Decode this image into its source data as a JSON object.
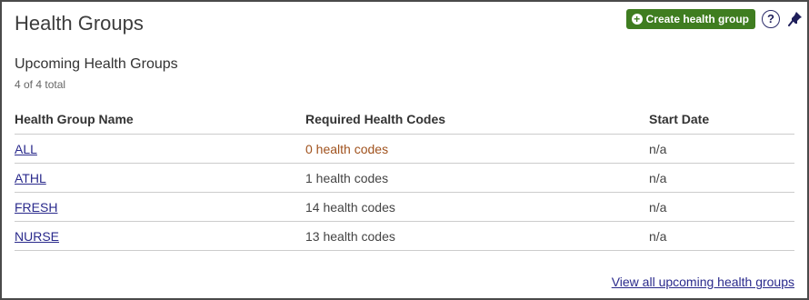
{
  "panel": {
    "title": "Health Groups",
    "create_button_label": "Create health group",
    "help_label": "?"
  },
  "section": {
    "title": "Upcoming Health Groups",
    "count": "4 of 4 total"
  },
  "table": {
    "headers": [
      "Health Group Name",
      "Required Health Codes",
      "Start Date"
    ],
    "rows": [
      {
        "name": "ALL",
        "codes": "0 health codes",
        "start": "n/a"
      },
      {
        "name": "ATHL",
        "codes": "1 health codes",
        "start": "n/a"
      },
      {
        "name": "FRESH",
        "codes": "14 health codes",
        "start": "n/a"
      },
      {
        "name": "NURSE",
        "codes": "13 health codes",
        "start": "n/a"
      }
    ]
  },
  "footer": {
    "view_all_label": "View all upcoming health groups"
  },
  "icons": {
    "create": "plus-circle-icon",
    "help": "question-icon",
    "pin": "pin-icon"
  },
  "colors": {
    "primary_button": "#3f7d20",
    "link": "#2a2a8c",
    "zero_codes": "#a0521d"
  }
}
